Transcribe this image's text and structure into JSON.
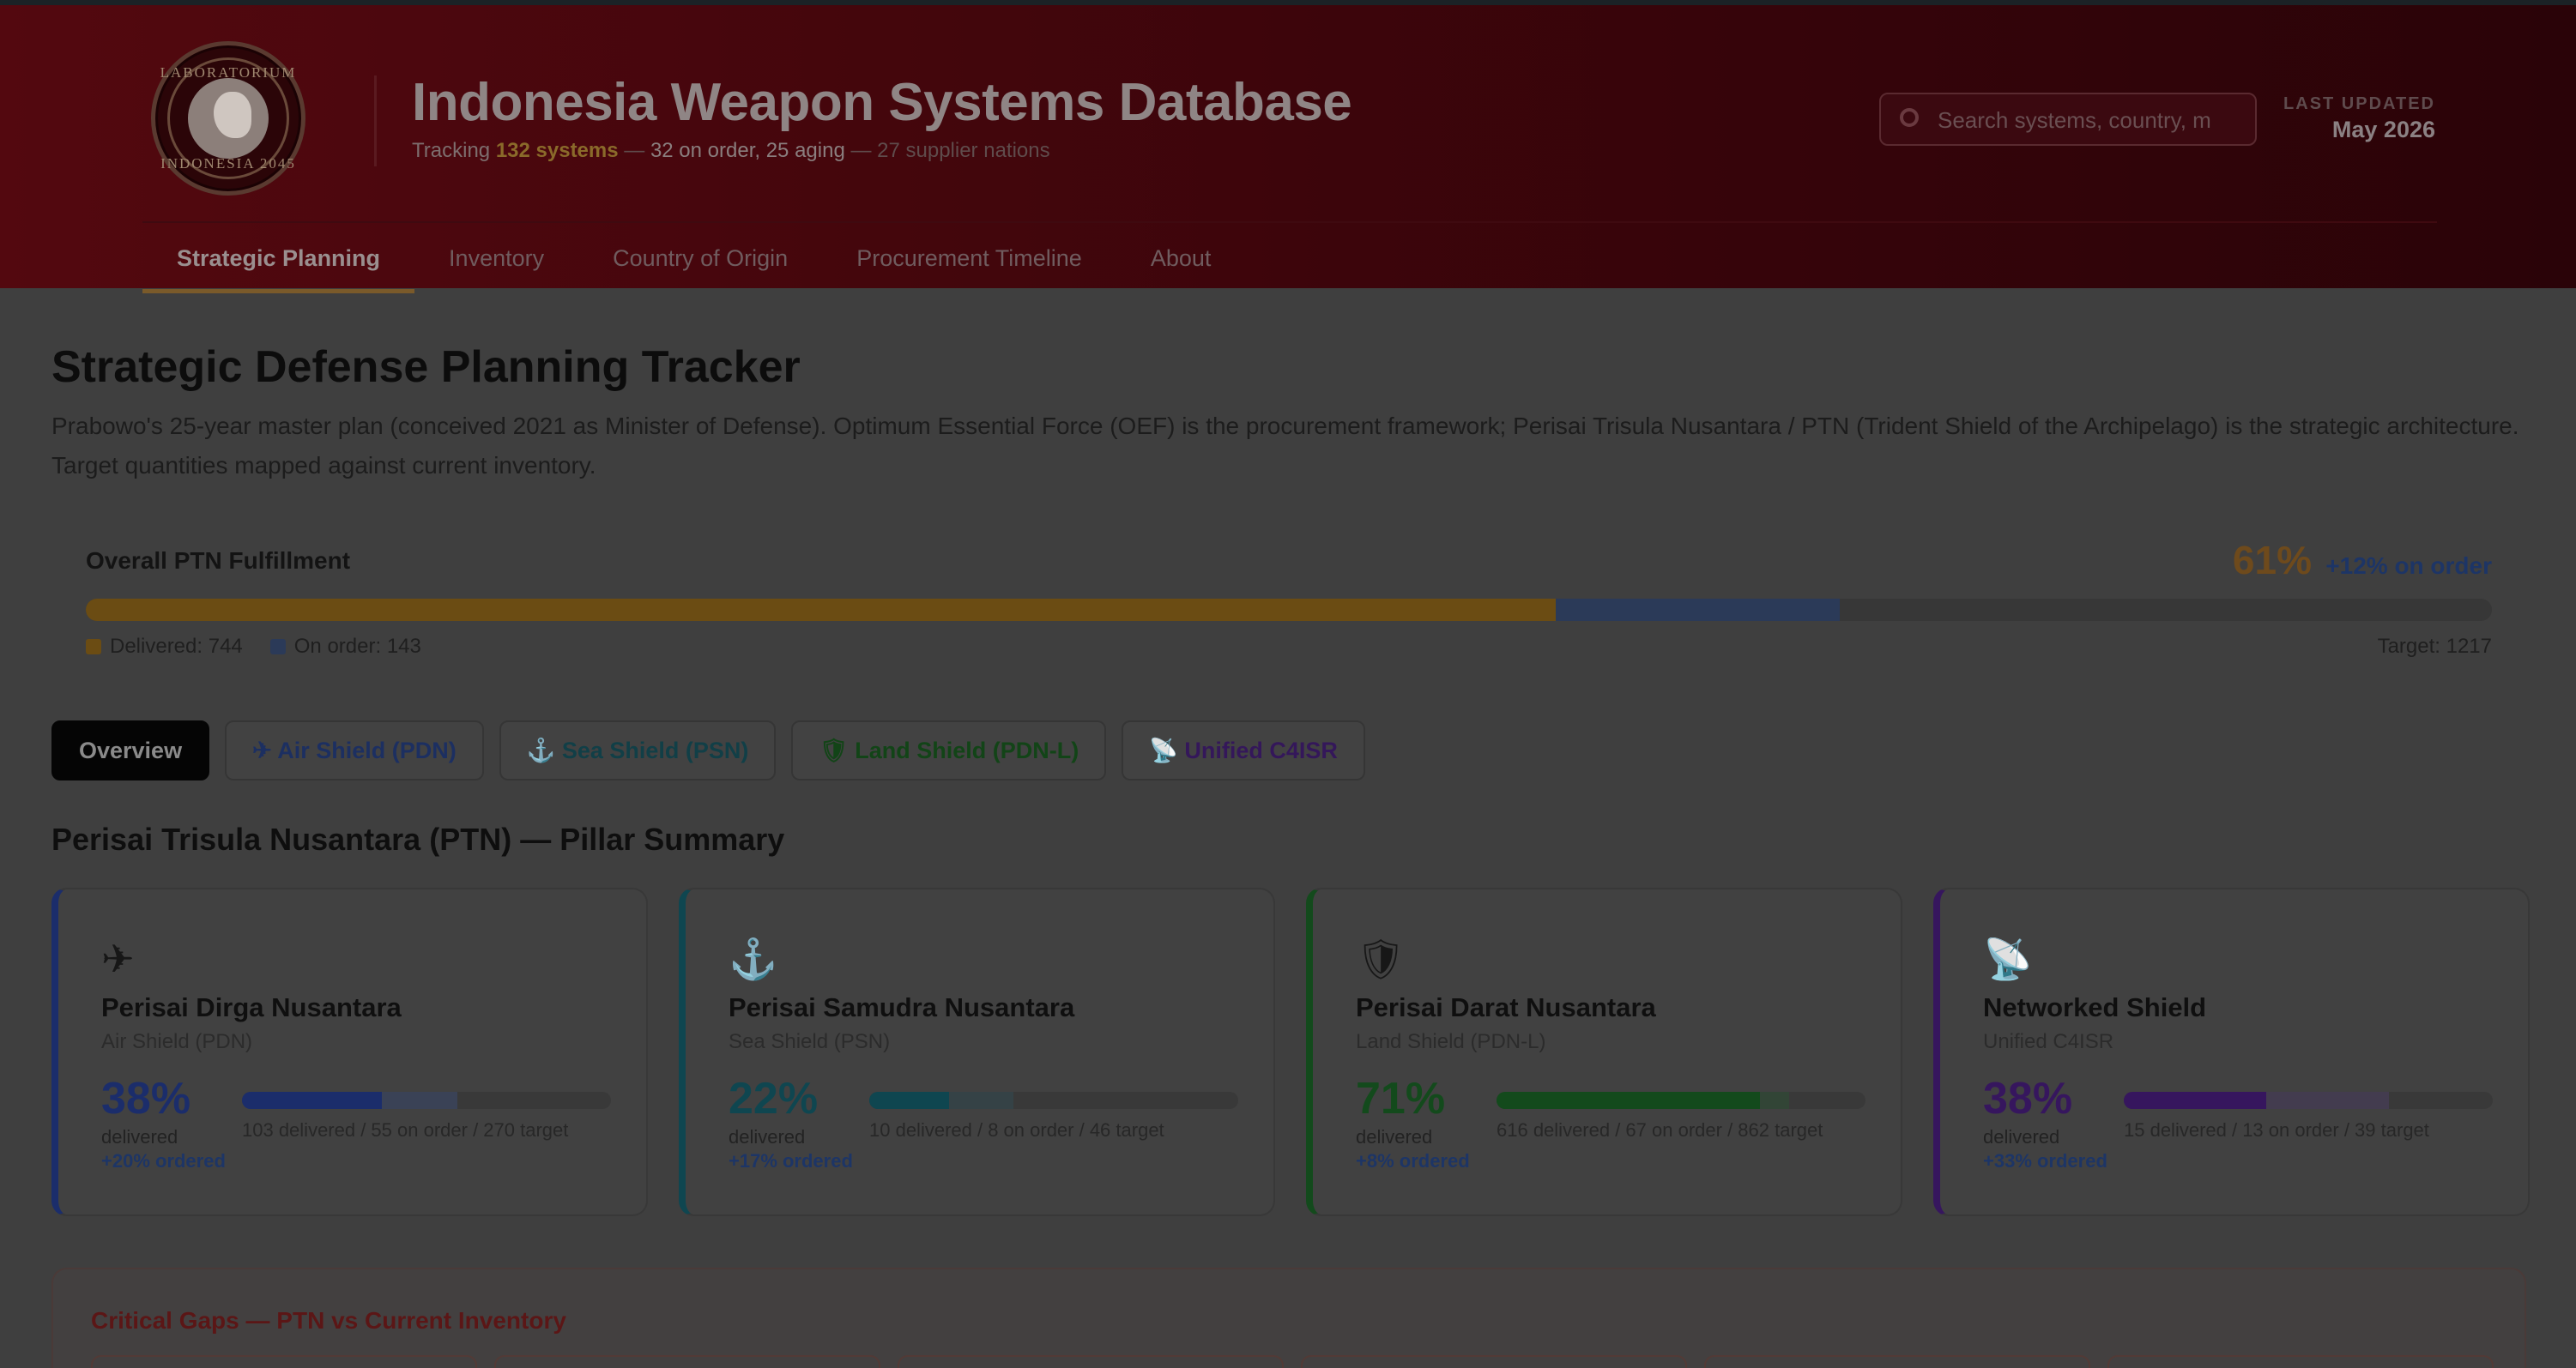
{
  "header": {
    "logo_text_top": "LABORATORIUM",
    "logo_text_bottom": "INDONESIA 2045",
    "title": "Indonesia Weapon Systems Database",
    "subtitle_prefix": "Tracking",
    "subtitle_systems": "132 systems",
    "subtitle_sep1": "—",
    "subtitle_mid": "32 on order, 25 aging",
    "subtitle_sep2": "—",
    "subtitle_suppliers": "27 supplier nations",
    "search_placeholder": "Search systems, country, m",
    "last_updated_label": "LAST UPDATED",
    "last_updated_value": "May 2026"
  },
  "nav": {
    "items": [
      {
        "label": "Strategic Planning",
        "active": true
      },
      {
        "label": "Inventory",
        "active": false
      },
      {
        "label": "Country of Origin",
        "active": false
      },
      {
        "label": "Procurement Timeline",
        "active": false
      },
      {
        "label": "About",
        "active": false
      }
    ]
  },
  "main": {
    "title": "Strategic Defense Planning Tracker",
    "description": "Prabowo's 25-year master plan (conceived 2021 as Minister of Defense). Optimum Essential Force (OEF) is the procurement framework; Perisai Trisula Nusantara / PTN (Trident Shield of the Archipelago) is the strategic architecture. Target quantities mapped against current inventory."
  },
  "fulfillment": {
    "label": "Overall PTN Fulfillment",
    "percent": "61%",
    "on_order_text": "+12% on order",
    "delivered_fraction": 0.611,
    "on_order_fraction": 0.118,
    "legend_delivered": "Delivered: 744",
    "legend_on_order": "On order: 143",
    "target": "Target: 1217"
  },
  "tabs": [
    {
      "label": "Overview",
      "icon": "",
      "cls": "active"
    },
    {
      "label": "Air Shield (PDN)",
      "icon": "✈",
      "cls": "air"
    },
    {
      "label": "Sea Shield (PSN)",
      "icon": "⚓",
      "cls": "sea"
    },
    {
      "label": "Land Shield (PDN-L)",
      "icon": "🛡",
      "cls": "land"
    },
    {
      "label": "Unified C4ISR",
      "icon": "📡",
      "cls": "c4"
    }
  ],
  "pillar_summary": {
    "title": "Perisai Trisula Nusantara (PTN) — Pillar Summary",
    "cards": [
      {
        "icon": "✈",
        "icon_name": "airplane-icon",
        "name": "Perisai Dirga Nusantara",
        "sub": "Air Shield (PDN)",
        "pct": "38%",
        "delivered_label": "delivered",
        "ordered": "+20% ordered",
        "stat": "103 delivered / 55 on order / 270 target",
        "delivered_frac": 0.38,
        "order_frac": 0.204,
        "color": "#1b2d6b",
        "fill": "#1b2d6b",
        "fill2": "#3a4256"
      },
      {
        "icon": "⚓",
        "icon_name": "anchor-icon",
        "name": "Perisai Samudra Nusantara",
        "sub": "Sea Shield (PSN)",
        "pct": "22%",
        "delivered_label": "delivered",
        "ordered": "+17% ordered",
        "stat": "10 delivered / 8 on order / 46 target",
        "delivered_frac": 0.217,
        "order_frac": 0.174,
        "color": "#0f4650",
        "fill": "#0f4650",
        "fill2": "#354246"
      },
      {
        "icon": "🛡",
        "icon_name": "shield-icon",
        "name": "Perisai Darat Nusantara",
        "sub": "Land Shield (PDN-L)",
        "pct": "71%",
        "delivered_label": "delivered",
        "ordered": "+8% ordered",
        "stat": "616 delivered / 67 on order / 862 target",
        "delivered_frac": 0.715,
        "order_frac": 0.078,
        "color": "#134a1c",
        "fill": "#134a1c",
        "fill2": "#324536"
      },
      {
        "icon": "📡",
        "icon_name": "satellite-dish-icon",
        "name": "Networked Shield",
        "sub": "Unified C4ISR",
        "pct": "38%",
        "delivered_label": "delivered",
        "ordered": "+33% ordered",
        "stat": "15 delivered / 13 on order / 39 target",
        "delivered_frac": 0.385,
        "order_frac": 0.333,
        "color": "#36165e",
        "fill": "#36165e",
        "fill2": "#433c4f"
      }
    ]
  },
  "critical_gaps": {
    "title": "Critical Gaps — PTN vs Current Inventory"
  },
  "colors": {
    "header_bg": "#53080f",
    "delivered": "#6b4c13",
    "on_order": "#2b3a58",
    "air": "#1b2d6b",
    "sea": "#0f4650",
    "land": "#134a1c",
    "c4isr": "#36165e"
  }
}
